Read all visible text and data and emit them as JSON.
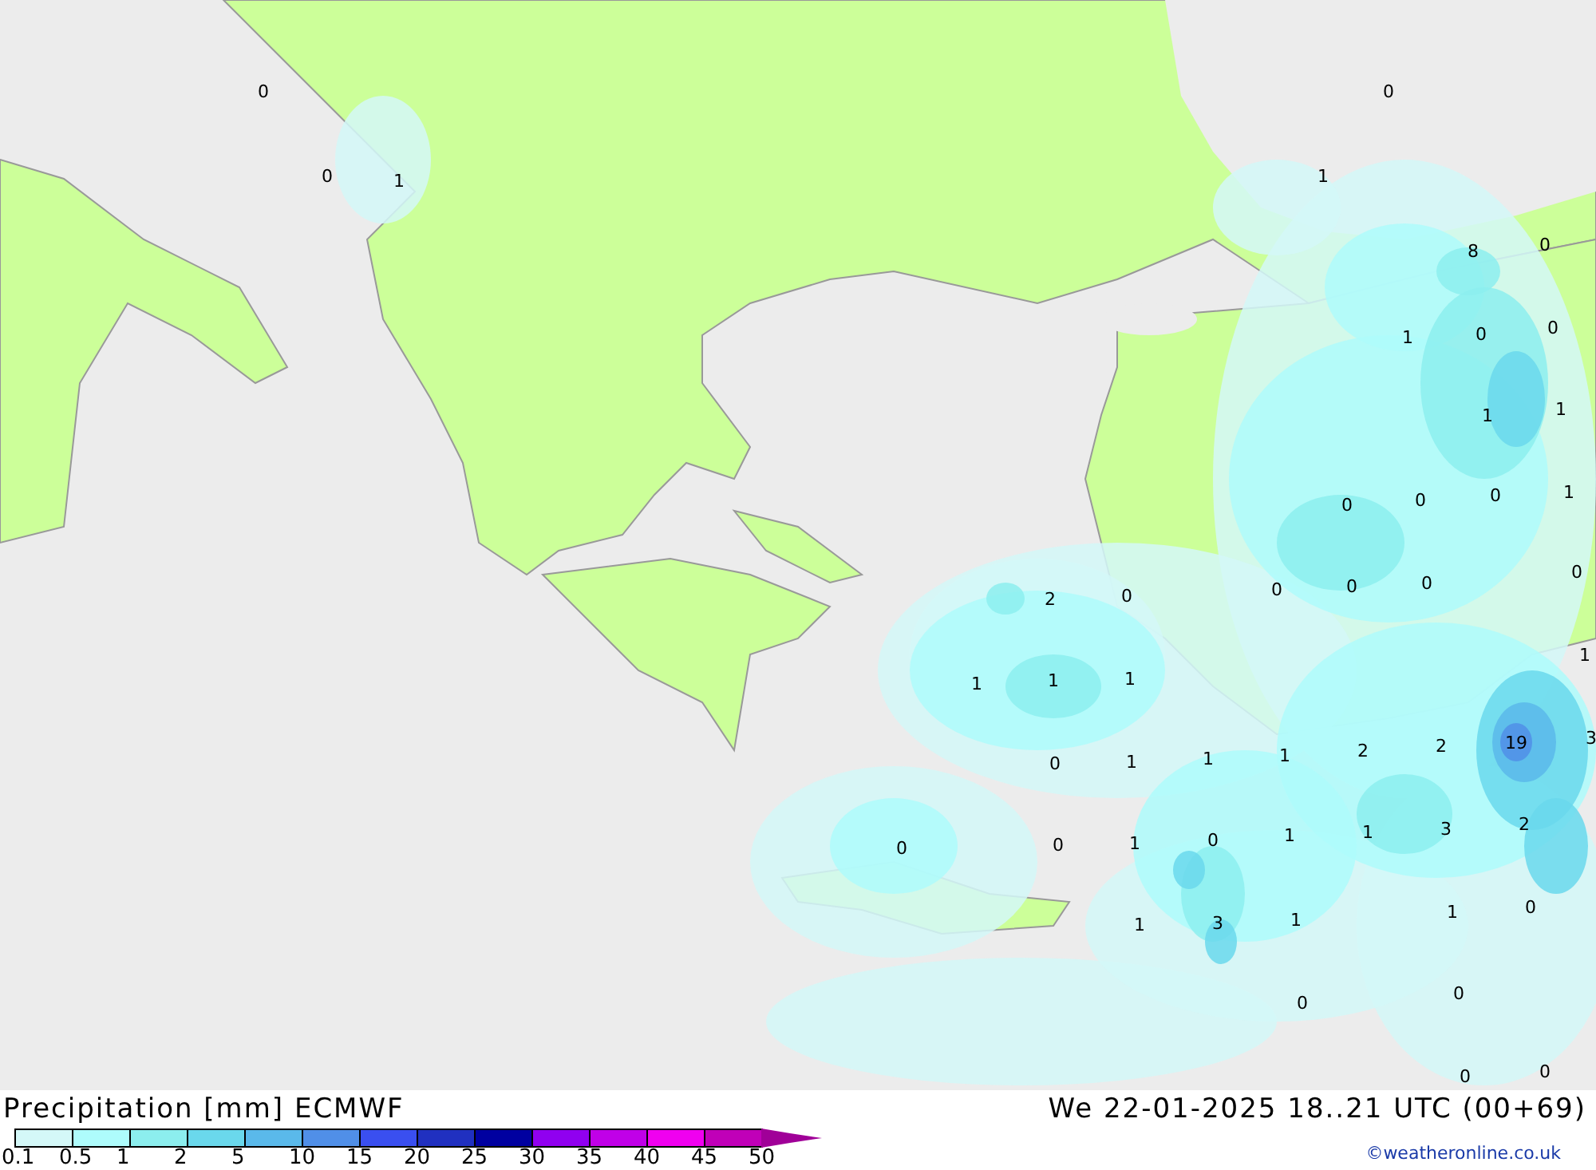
{
  "map": {
    "value_labels": [
      "0",
      "0",
      "0",
      "1",
      "1",
      "8",
      "0",
      "1",
      "0",
      "0",
      "1",
      "1",
      "0",
      "0",
      "0",
      "1",
      "2",
      "0",
      "0",
      "0",
      "0",
      "0",
      "1",
      "1",
      "1",
      "1",
      "0",
      "1",
      "1",
      "1",
      "2",
      "2",
      "19",
      "3",
      "0",
      "0",
      "1",
      "0",
      "1",
      "1",
      "3",
      "2",
      "1",
      "3",
      "1",
      "1",
      "0",
      "0",
      "0",
      "0",
      "0"
    ]
  },
  "footer": {
    "title": "Precipitation [mm] ECMWF",
    "valid_time": "We 22-01-2025 18..21 UTC (00+69)",
    "credit": "©weatheronline.co.uk"
  },
  "legend": {
    "bins": [
      {
        "color": "#d4f8f8"
      },
      {
        "color": "#aefcfc"
      },
      {
        "color": "#8ceeee"
      },
      {
        "color": "#6ad8ec"
      },
      {
        "color": "#5ab9ea"
      },
      {
        "color": "#508fe8"
      },
      {
        "color": "#3a4ff0"
      },
      {
        "color": "#2030c0"
      },
      {
        "color": "#0000a0"
      },
      {
        "color": "#9000f0"
      },
      {
        "color": "#c000e8"
      },
      {
        "color": "#f000f0"
      },
      {
        "color": "#c000b8"
      },
      {
        "color": "#a00098",
        "kind": "arrow"
      }
    ],
    "labels": [
      "0.1",
      "0.5",
      "1",
      "2",
      "5",
      "10",
      "15",
      "20",
      "25",
      "30",
      "35",
      "40",
      "45",
      "50"
    ]
  }
}
